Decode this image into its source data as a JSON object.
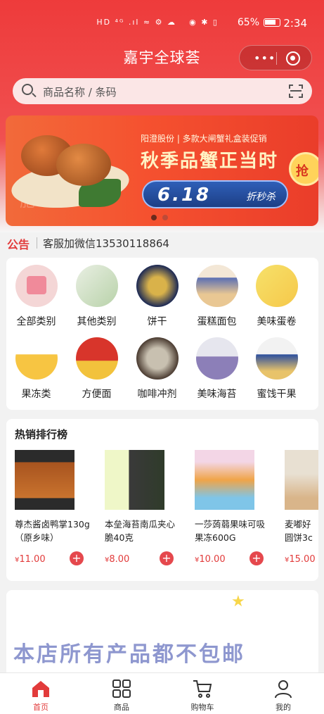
{
  "status_bar": {
    "left_icons": "HD ⁴ᴳ .ıl ≈ ⚙ ☁",
    "right_icons": "◉ ✱ ▯",
    "battery": "65%",
    "time": "2:34"
  },
  "header": {
    "title": "嘉宇全球荟",
    "menu_glyph": "•••"
  },
  "search": {
    "placeholder": "商品名称 / 条码"
  },
  "banner": {
    "brand_line": "阳澄股份 | 多款大闸蟹礼盒装促销",
    "headline": "秋季品蟹正当时",
    "sale_number": "6.18",
    "sale_text": "折秒杀",
    "grab_label": "抢",
    "calligraphy": "蟹肥"
  },
  "notice": {
    "tag": "公告",
    "message": "客服加微信13530118864"
  },
  "categories": [
    {
      "label": "全部类别"
    },
    {
      "label": "其他类别"
    },
    {
      "label": "饼干"
    },
    {
      "label": "蛋糕面包"
    },
    {
      "label": "美味蛋卷"
    },
    {
      "label": "果冻类"
    },
    {
      "label": "方便面"
    },
    {
      "label": "咖啡冲剂"
    },
    {
      "label": "美味海苔"
    },
    {
      "label": "蜜饯干果"
    }
  ],
  "hot": {
    "title": "热销排行榜",
    "products": [
      {
        "name": "尊杰酱卤鸭掌130g（原乡味）",
        "currency": "¥",
        "price": "11.00"
      },
      {
        "name": "本垒海苔南瓜夹心脆40克",
        "currency": "¥",
        "price": "8.00"
      },
      {
        "name": "一莎蒟蒻果味可吸果冻600G",
        "currency": "¥",
        "price": "10.00"
      },
      {
        "name": "麦嘟好圆饼3c",
        "currency": "¥",
        "price": "15.00"
      }
    ]
  },
  "promo": {
    "text": "本店所有产品都不包邮"
  },
  "tabbar": [
    {
      "label": "首页",
      "active": true
    },
    {
      "label": "商品",
      "active": false
    },
    {
      "label": "购物车",
      "active": false
    },
    {
      "label": "我的",
      "active": false
    }
  ],
  "colors": {
    "accent": "#e23b3b",
    "hero": "#ee3b3b",
    "promo_text": "#8e97cf"
  }
}
